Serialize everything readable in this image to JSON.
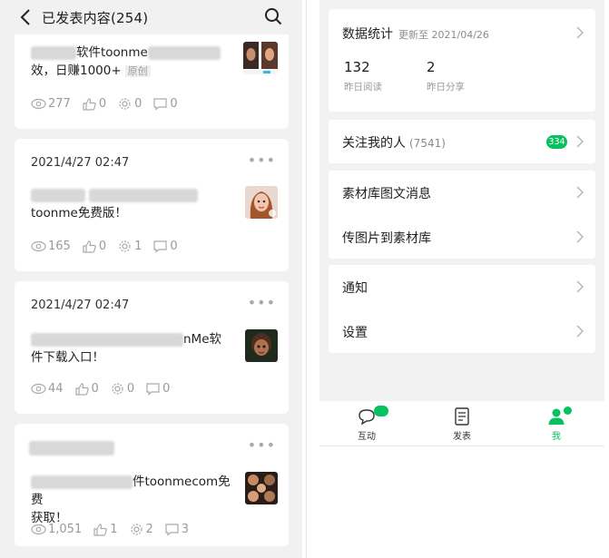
{
  "left": {
    "title": "已发表内容(254)",
    "posts": [
      {
        "date": "",
        "text_line1_visible": "软件toonme",
        "text_line2": "效，日赚1000+",
        "tag": "原创",
        "views": "277",
        "likes": "0",
        "shares": "0",
        "comments": "0"
      },
      {
        "date": "2021/4/27 02:47",
        "text_line2": "toonme免费版！",
        "views": "165",
        "likes": "0",
        "shares": "1",
        "comments": "0"
      },
      {
        "date": "2021/4/27 02:47",
        "text_line1_visible": "nMe软",
        "text_line2": "件下载入口！",
        "views": "44",
        "likes": "0",
        "shares": "0",
        "comments": "0"
      },
      {
        "date": "",
        "text_line1_visible": "件toonmecom免费",
        "text_line2": "获取！",
        "views": "1,051",
        "likes": "1",
        "shares": "2",
        "comments": "3"
      }
    ]
  },
  "right": {
    "stats": {
      "title": "数据统计",
      "updated": "更新至 2021/04/26",
      "reads_value": "132",
      "reads_label": "昨日阅读",
      "shares_value": "2",
      "shares_label": "昨日分享"
    },
    "followers": {
      "label": "关注我的人",
      "count": "(7541)",
      "badge": "334"
    },
    "library": {
      "item1": "素材库图文消息",
      "item2": "传图片到素材库"
    },
    "misc": {
      "item1": "通知",
      "item2": "设置"
    },
    "tabs": [
      {
        "label": "互动",
        "icon": "chat-icon"
      },
      {
        "label": "发表",
        "icon": "document-icon"
      },
      {
        "label": "我",
        "icon": "person-icon"
      }
    ],
    "accent": "#07c160"
  }
}
